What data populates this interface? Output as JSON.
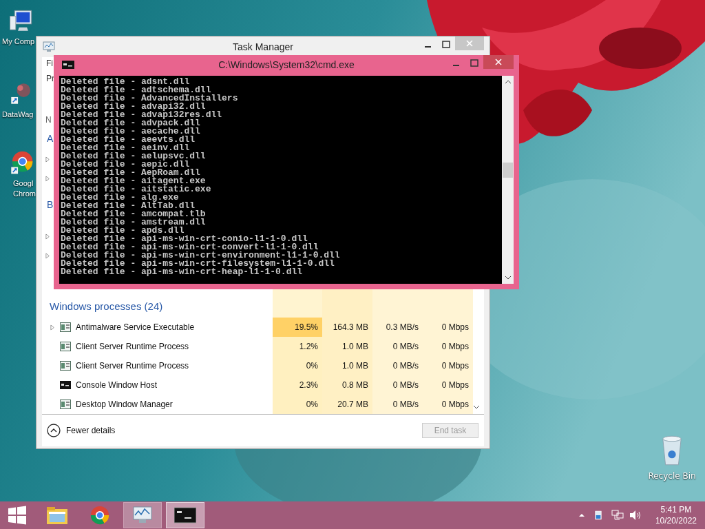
{
  "desktop_icons": [
    {
      "kind": "computer",
      "lines": [
        "My Comp"
      ]
    },
    {
      "kind": "shortcut",
      "lines": [
        "DataWag"
      ]
    },
    {
      "kind": "chrome",
      "lines": [
        "Googl",
        "Chrom"
      ]
    }
  ],
  "recycle_bin": {
    "label": "Recycle Bin"
  },
  "task_manager": {
    "title": "Task Manager",
    "menu": "Fi",
    "tab": "Pr",
    "header": "N",
    "groups": [
      {
        "title": "A",
        "rows": [
          {
            "expandable": true
          },
          {
            "expandable": true
          }
        ]
      },
      {
        "title": "B",
        "rows": [
          {
            "expandable": true
          },
          {
            "expandable": true
          }
        ]
      }
    ],
    "section": {
      "title": "Windows processes (24)",
      "rows": [
        {
          "name": "Antimalware Service Executable",
          "kind": "app",
          "expandable": true,
          "cpu_hot": true,
          "cpu": "19.5%",
          "memory": "164.3 MB",
          "disk": "0.3 MB/s",
          "network": "0 Mbps"
        },
        {
          "name": "Client Server Runtime Process",
          "kind": "app",
          "expandable": false,
          "cpu_hot": false,
          "cpu": "1.2%",
          "memory": "1.0 MB",
          "disk": "0 MB/s",
          "network": "0 Mbps"
        },
        {
          "name": "Client Server Runtime Process",
          "kind": "app",
          "expandable": false,
          "cpu_hot": false,
          "cpu": "0%",
          "memory": "1.0 MB",
          "disk": "0 MB/s",
          "network": "0 Mbps"
        },
        {
          "name": "Console Window Host",
          "kind": "console",
          "expandable": false,
          "cpu_hot": false,
          "cpu": "2.3%",
          "memory": "0.8 MB",
          "disk": "0 MB/s",
          "network": "0 Mbps"
        },
        {
          "name": "Desktop Window Manager",
          "kind": "app",
          "expandable": false,
          "cpu_hot": false,
          "cpu": "0%",
          "memory": "20.7 MB",
          "disk": "0 MB/s",
          "network": "0 Mbps"
        }
      ]
    },
    "fewer_details": "Fewer details",
    "end_task": {
      "label": "End task",
      "disabled": true
    }
  },
  "cmd": {
    "title": "C:\\Windows\\System32\\cmd.exe",
    "lines": [
      "Deleted file - adsnt.dll",
      "Deleted file - adtschema.dll",
      "Deleted file - AdvancedInstallers",
      "Deleted file - advapi32.dll",
      "Deleted file - advapi32res.dll",
      "Deleted file - advpack.dll",
      "Deleted file - aecache.dll",
      "Deleted file - aeevts.dll",
      "Deleted file - aeinv.dll",
      "Deleted file - aelupsvc.dll",
      "Deleted file - aepic.dll",
      "Deleted file - AepRoam.dll",
      "Deleted file - aitagent.exe",
      "Deleted file - aitstatic.exe",
      "Deleted file - alg.exe",
      "Deleted file - AltTab.dll",
      "Deleted file - amcompat.tlb",
      "Deleted file - amstream.dll",
      "Deleted file - apds.dll",
      "Deleted file - api-ms-win-crt-conio-l1-1-0.dll",
      "Deleted file - api-ms-win-crt-convert-l1-1-0.dll",
      "Deleted file - api-ms-win-crt-environment-l1-1-0.dll",
      "Deleted file - api-ms-win-crt-filesystem-l1-1-0.dll",
      "Deleted file - api-ms-win-crt-heap-l1-1-0.dll"
    ]
  },
  "taskbar": {
    "items": [
      {
        "kind": "explorer",
        "running": false,
        "selected": false
      },
      {
        "kind": "chrome",
        "running": false,
        "selected": false
      },
      {
        "kind": "taskmgr",
        "running": true,
        "selected": false
      },
      {
        "kind": "cmd",
        "running": true,
        "selected": true
      }
    ],
    "time": "5:41 PM",
    "date": "10/20/2022"
  }
}
